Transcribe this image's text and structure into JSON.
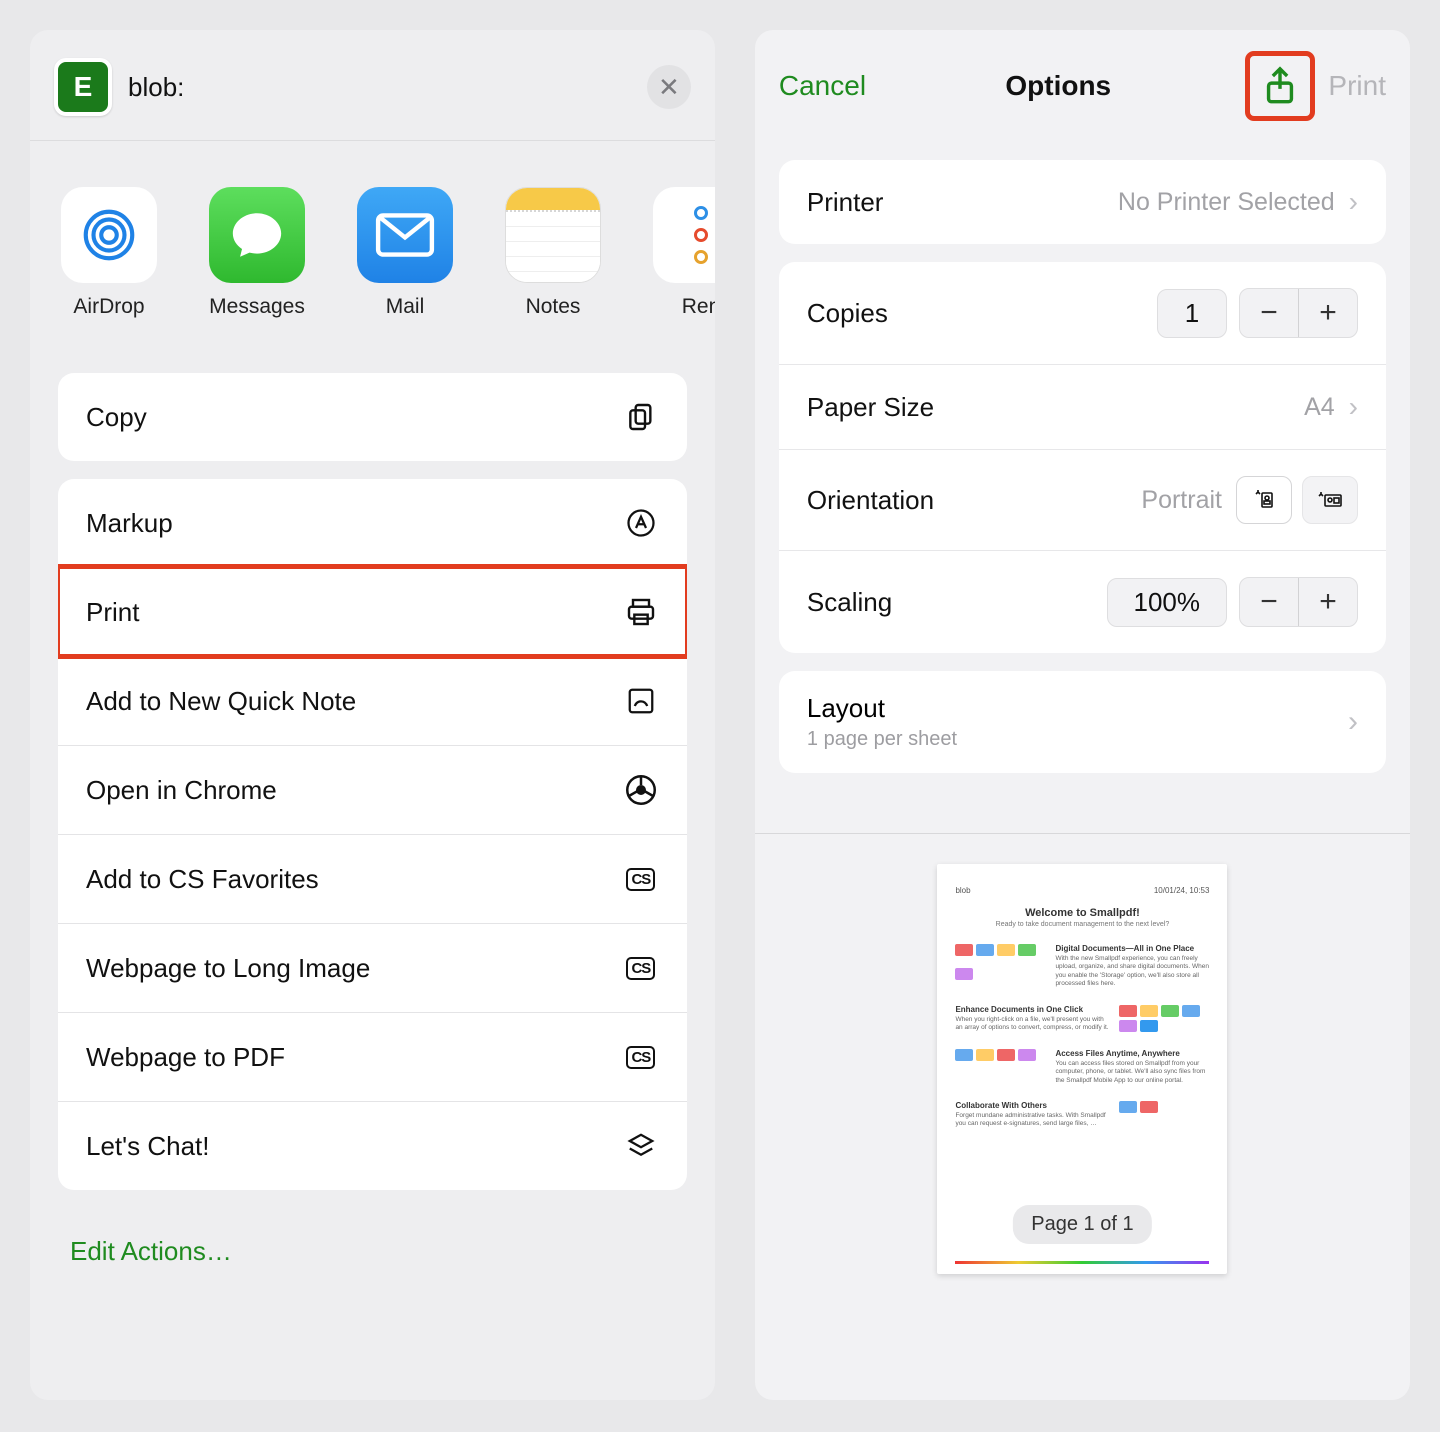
{
  "share": {
    "app_icon_letter": "E",
    "url_label": "blob:",
    "targets": [
      {
        "label": "AirDrop"
      },
      {
        "label": "Messages"
      },
      {
        "label": "Mail"
      },
      {
        "label": "Notes"
      },
      {
        "label": "Ren"
      }
    ],
    "copy_label": "Copy",
    "actions": [
      {
        "label": "Markup"
      },
      {
        "label": "Print",
        "highlight": true
      },
      {
        "label": "Add to New Quick Note"
      },
      {
        "label": "Open in Chrome"
      },
      {
        "label": "Add to CS Favorites"
      },
      {
        "label": "Webpage to Long Image"
      },
      {
        "label": "Webpage to PDF"
      },
      {
        "label": "Let's Chat!"
      }
    ],
    "edit_actions_label": "Edit Actions…"
  },
  "options": {
    "cancel_label": "Cancel",
    "title": "Options",
    "print_label": "Print",
    "printer_label": "Printer",
    "printer_value": "No Printer Selected",
    "copies_label": "Copies",
    "copies_value": "1",
    "paper_label": "Paper Size",
    "paper_value": "A4",
    "orientation_label": "Orientation",
    "orientation_value": "Portrait",
    "scaling_label": "Scaling",
    "scaling_value": "100%",
    "layout_label": "Layout",
    "layout_sub": "1 page per sheet",
    "preview": {
      "header_left": "blob",
      "header_right": "10/01/24, 10:53",
      "title": "Welcome to Smallpdf!",
      "subtitle": "Ready to take document management to the next level?",
      "sections": [
        {
          "heading": "Digital Documents—All in One Place",
          "body": "With the new Smallpdf experience, you can freely upload, organize, and share digital documents. When you enable the 'Storage' option, we'll also store all processed files here."
        },
        {
          "heading": "Enhance Documents in One Click",
          "body": "When you right-click on a file, we'll present you with an array of options to convert, compress, or modify it."
        },
        {
          "heading": "Access Files Anytime, Anywhere",
          "body": "You can access files stored on Smallpdf from your computer, phone, or tablet. We'll also sync files from the Smallpdf Mobile App to our online portal."
        },
        {
          "heading": "Collaborate With Others",
          "body": "Forget mundane administrative tasks. With Smallpdf you can request e-signatures, send large files, …"
        }
      ],
      "page_badge": "Page 1 of 1"
    }
  }
}
